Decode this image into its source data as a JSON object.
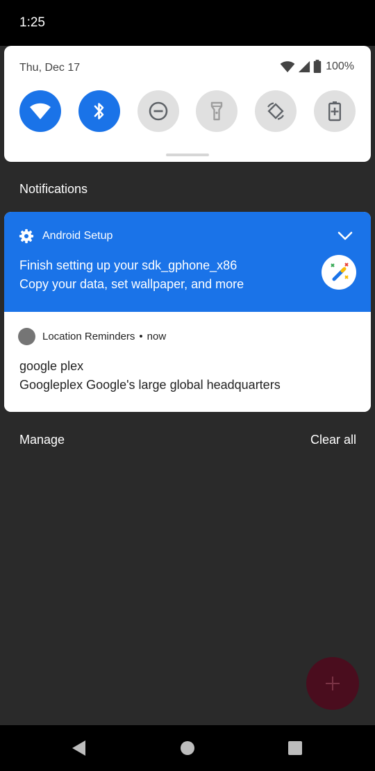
{
  "status_bar": {
    "time": "1:25"
  },
  "quick_settings": {
    "date": "Thu, Dec 17",
    "battery_percent": "100%",
    "tiles": [
      {
        "icon": "wifi-icon",
        "state": "on"
      },
      {
        "icon": "bluetooth-icon",
        "state": "on"
      },
      {
        "icon": "do-not-disturb-icon",
        "state": "off"
      },
      {
        "icon": "flashlight-icon",
        "state": "off"
      },
      {
        "icon": "auto-rotate-icon",
        "state": "off"
      },
      {
        "icon": "battery-saver-icon",
        "state": "off"
      }
    ]
  },
  "notifications": {
    "section_title": "Notifications",
    "items": [
      {
        "app": "Android Setup",
        "title": "Finish setting up your sdk_gphone_x86",
        "text": "Copy your data, set wallpaper, and more",
        "icon": "magic-wand-icon",
        "accent": "#1a73e8"
      },
      {
        "app": "Location Reminders",
        "separator": "•",
        "time": "now",
        "title": "google plex",
        "text": "Googleplex Google's large global headquarters"
      }
    ],
    "manage_label": "Manage",
    "clear_all_label": "Clear all"
  },
  "fab": {
    "icon": "plus-icon"
  },
  "nav_bar": {
    "buttons": [
      "back-icon",
      "home-icon",
      "recents-icon"
    ]
  }
}
